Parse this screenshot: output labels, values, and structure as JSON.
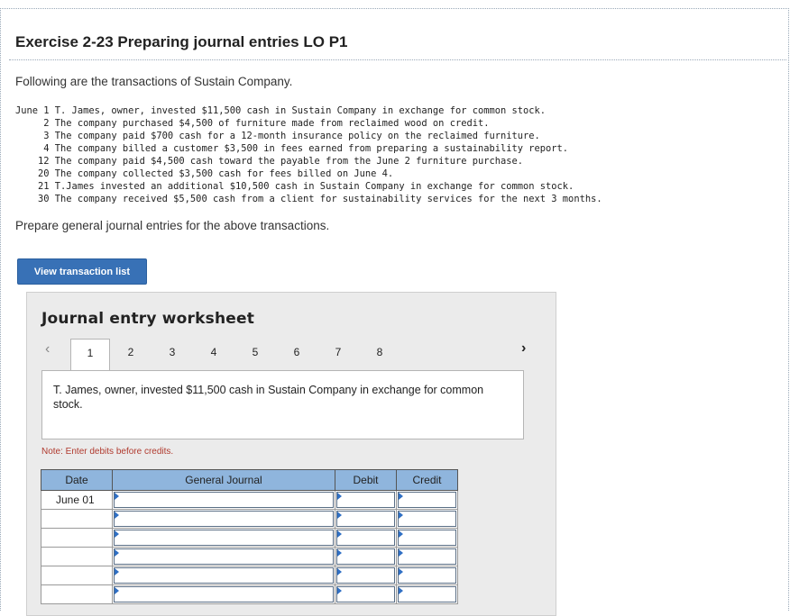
{
  "header": {
    "title": "Exercise 2-23 Preparing journal entries LO P1"
  },
  "intro": "Following are the transactions of Sustain Company.",
  "transactions": [
    "June 1 T. James, owner, invested $11,500 cash in Sustain Company in exchange for common stock.",
    "     2 The company purchased $4,500 of furniture made from reclaimed wood on credit.",
    "     3 The company paid $700 cash for a 12-month insurance policy on the reclaimed furniture.",
    "     4 The company billed a customer $3,500 in fees earned from preparing a sustainability report.",
    "    12 The company paid $4,500 cash toward the payable from the June 2 furniture purchase.",
    "    20 The company collected $3,500 cash for fees billed on June 4.",
    "    21 T.James invested an additional $10,500 cash in Sustain Company in exchange for common stock.",
    "    30 The company received $5,500 cash from a client for sustainability services for the next 3 months."
  ],
  "instruction": "Prepare general journal entries for the above transactions.",
  "buttons": {
    "view_transactions": "View transaction list"
  },
  "worksheet": {
    "title": "Journal entry worksheet",
    "prev_icon": "‹",
    "next_icon": "›",
    "pages": [
      "1",
      "2",
      "3",
      "4",
      "5",
      "6",
      "7",
      "8"
    ],
    "active_page": "1",
    "description": "T. James, owner, invested $11,500 cash in Sustain Company in exchange for common stock.",
    "note": "Note: Enter debits before credits.",
    "table": {
      "headers": [
        "Date",
        "General Journal",
        "Debit",
        "Credit"
      ],
      "rows": [
        {
          "date": "June 01",
          "account": "",
          "debit": "",
          "credit": ""
        },
        {
          "date": "",
          "account": "",
          "debit": "",
          "credit": ""
        },
        {
          "date": "",
          "account": "",
          "debit": "",
          "credit": ""
        },
        {
          "date": "",
          "account": "",
          "debit": "",
          "credit": ""
        },
        {
          "date": "",
          "account": "",
          "debit": "",
          "credit": ""
        },
        {
          "date": "",
          "account": "",
          "debit": "",
          "credit": ""
        }
      ]
    }
  },
  "colors": {
    "button_bg": "#3871b6",
    "header_bg": "#8fb5dd",
    "note_text": "#b03a2e",
    "input_marker": "#2f6fc4"
  }
}
